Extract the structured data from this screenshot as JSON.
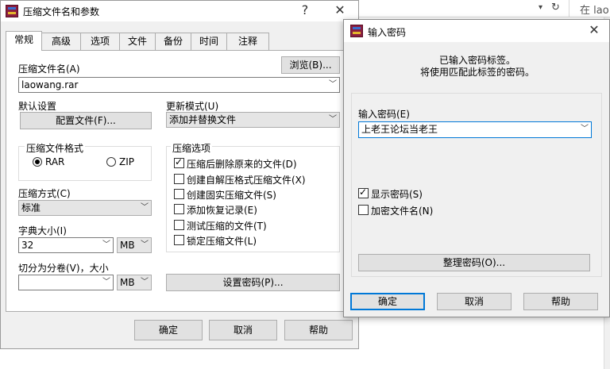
{
  "background": {
    "address_text": "在 lao",
    "chevron_icon": "chevron-down-icon",
    "refresh_icon": "refresh-icon"
  },
  "main_dialog": {
    "title": "压缩文件名和参数",
    "help_glyph": "?",
    "close_glyph": "✕",
    "tabs": [
      "常规",
      "高级",
      "选项",
      "文件",
      "备份",
      "时间",
      "注释"
    ],
    "archive_name_label": "压缩文件名(A)",
    "browse_label": "浏览(B)...",
    "archive_name_value": "laowang.rar",
    "default_settings_label": "默认设置",
    "profiles_label": "配置文件(F)...",
    "update_mode_label": "更新模式(U)",
    "update_mode_value": "添加并替换文件",
    "format_group_label": "压缩文件格式",
    "format_rar": "RAR",
    "format_zip": "ZIP",
    "options_group_label": "压缩选项",
    "options": [
      {
        "label": "压缩后删除原来的文件(D)",
        "checked": true
      },
      {
        "label": "创建自解压格式压缩文件(X)",
        "checked": false
      },
      {
        "label": "创建固实压缩文件(S)",
        "checked": false
      },
      {
        "label": "添加恢复记录(E)",
        "checked": false
      },
      {
        "label": "测试压缩的文件(T)",
        "checked": false
      },
      {
        "label": "锁定压缩文件(L)",
        "checked": false
      }
    ],
    "method_label": "压缩方式(C)",
    "method_value": "标准",
    "dict_label": "字典大小(I)",
    "dict_value": "32",
    "dict_unit": "MB",
    "split_label": "切分为分卷(V)，大小",
    "split_value": "",
    "split_unit": "MB",
    "set_password_label": "设置密码(P)...",
    "ok_label": "确定",
    "cancel_label": "取消",
    "help_label": "帮助"
  },
  "password_dialog": {
    "title": "输入密码",
    "close_glyph": "✕",
    "info_line1": "已输入密码标签。",
    "info_line2": "将使用匹配此标签的密码。",
    "password_label": "输入密码(E)",
    "password_value": "上老王论坛当老王",
    "show_password_label": "显示密码(S)",
    "show_password_checked": true,
    "encrypt_names_label": "加密文件名(N)",
    "encrypt_names_checked": false,
    "organize_label": "整理密码(O)...",
    "ok_label": "确定",
    "cancel_label": "取消",
    "help_label": "帮助"
  }
}
